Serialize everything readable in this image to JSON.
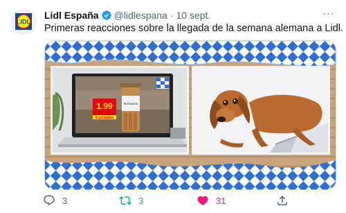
{
  "tweet": {
    "author_name": "Lidl España",
    "handle": "@lidlespana",
    "separator": "·",
    "date": "10 sept.",
    "more_label": "···",
    "text": "Primeras reacciones sobre la llegada de la semana alemana a Lidl.",
    "avatar_icon": "lidl-logo",
    "verified_icon": "verified-badge-icon"
  },
  "media": {
    "left_image": {
      "price": "1.99",
      "price_note": "8 unidades",
      "product_label": "Bockwurst"
    }
  },
  "actions": {
    "reply_count": "3",
    "retweet_count": "3",
    "like_count": "31"
  },
  "colors": {
    "retweet_active": "#00ba7c",
    "like_active": "#f91880",
    "icon_gray": "#536471",
    "bavarian_blue": "#2f6fd1"
  }
}
